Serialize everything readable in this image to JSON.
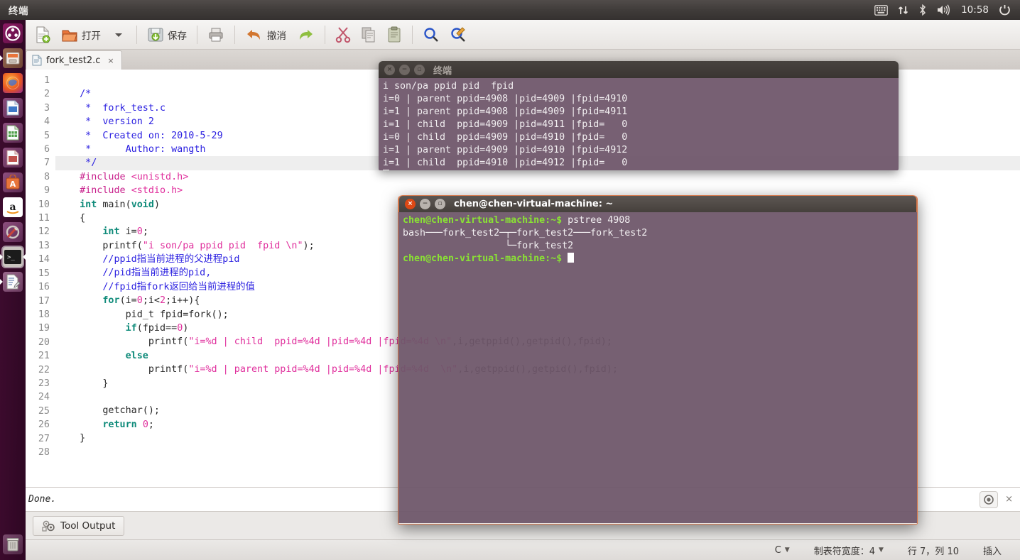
{
  "top_panel": {
    "app_title": "终端",
    "clock": "10:58",
    "tray_icons": [
      "keyboard-icon",
      "network-icon",
      "bluetooth-icon",
      "volume-icon",
      "power-icon"
    ]
  },
  "launcher": {
    "items": [
      {
        "name": "ubuntu-dash",
        "label": "Dash"
      },
      {
        "name": "files",
        "label": "文件"
      },
      {
        "name": "firefox",
        "label": "Firefox"
      },
      {
        "name": "libreoffice-writer",
        "label": "LibreOffice Writer"
      },
      {
        "name": "libreoffice-calc",
        "label": "LibreOffice Calc"
      },
      {
        "name": "libreoffice-impress",
        "label": "LibreOffice Impress"
      },
      {
        "name": "ubuntu-software-center",
        "label": "Ubuntu 软件中心"
      },
      {
        "name": "amazon",
        "label": "Amazon"
      },
      {
        "name": "system-settings",
        "label": "系统设置"
      },
      {
        "name": "terminal",
        "label": "终端"
      },
      {
        "name": "text-editor",
        "label": "文本编辑器"
      }
    ],
    "trash_label": "回收站"
  },
  "gedit": {
    "toolbar": [
      {
        "name": "new-file-button",
        "label": ""
      },
      {
        "name": "open-file-button",
        "label": "打开"
      },
      {
        "name": "open-dropdown-button",
        "label": ""
      },
      {
        "name": "save-button",
        "label": "保存"
      },
      {
        "name": "print-button",
        "label": ""
      },
      {
        "name": "undo-button",
        "label": "撤消"
      },
      {
        "name": "redo-button",
        "label": ""
      },
      {
        "name": "cut-button",
        "label": ""
      },
      {
        "name": "copy-button",
        "label": ""
      },
      {
        "name": "paste-button",
        "label": ""
      },
      {
        "name": "find-button",
        "label": ""
      },
      {
        "name": "replace-button",
        "label": ""
      }
    ],
    "tab": {
      "filename": "fork_test2.c",
      "close_label": "×"
    },
    "line_numbers": [
      "1",
      "2",
      "3",
      "4",
      "5",
      "6",
      "7",
      "8",
      "9",
      "10",
      "11",
      "12",
      "13",
      "14",
      "15",
      "16",
      "17",
      "18",
      "19",
      "20",
      "21",
      "22",
      "23",
      "24",
      "25",
      "26",
      "27",
      "28"
    ],
    "highlight_line": 7,
    "output": {
      "text": "Done.",
      "close_label": "×"
    },
    "bottom_tab": {
      "label": "Tool Output",
      "icon": "gears-icon"
    },
    "statusbar": {
      "language": "C",
      "tab_width": "制表符宽度：4",
      "position": "行 7，列 10",
      "insert_mode": "插入"
    }
  },
  "code_lines": [
    {
      "n": 1,
      "segs": []
    },
    {
      "n": 2,
      "segs": [
        {
          "t": "  ",
          "c": ""
        },
        {
          "t": "/*",
          "c": "cmt"
        }
      ]
    },
    {
      "n": 3,
      "segs": [
        {
          "t": "   *  fork_test.c",
          "c": "cmt"
        }
      ]
    },
    {
      "n": 4,
      "segs": [
        {
          "t": "   *  version 2",
          "c": "cmt"
        }
      ]
    },
    {
      "n": 5,
      "segs": [
        {
          "t": "   *  Created on: 2010-5-29",
          "c": "cmt"
        }
      ]
    },
    {
      "n": 6,
      "segs": [
        {
          "t": "   *      Author: wangth",
          "c": "cmt"
        }
      ]
    },
    {
      "n": 7,
      "segs": [
        {
          "t": "   */",
          "c": "cmt"
        }
      ]
    },
    {
      "n": 8,
      "segs": [
        {
          "t": "  ",
          "c": ""
        },
        {
          "t": "#include ",
          "c": "pp"
        },
        {
          "t": "<unistd.h>",
          "c": "pph"
        }
      ]
    },
    {
      "n": 9,
      "segs": [
        {
          "t": "  ",
          "c": ""
        },
        {
          "t": "#include ",
          "c": "pp"
        },
        {
          "t": "<stdio.h>",
          "c": "pph"
        }
      ]
    },
    {
      "n": 10,
      "segs": [
        {
          "t": "  ",
          "c": ""
        },
        {
          "t": "int",
          "c": "kw"
        },
        {
          "t": " main(",
          "c": ""
        },
        {
          "t": "void",
          "c": "kw"
        },
        {
          "t": ")",
          "c": ""
        }
      ]
    },
    {
      "n": 11,
      "segs": [
        {
          "t": "  {",
          "c": ""
        }
      ]
    },
    {
      "n": 12,
      "segs": [
        {
          "t": "      ",
          "c": ""
        },
        {
          "t": "int",
          "c": "kw"
        },
        {
          "t": " i=",
          "c": ""
        },
        {
          "t": "0",
          "c": "num"
        },
        {
          "t": ";",
          "c": ""
        }
      ]
    },
    {
      "n": 13,
      "segs": [
        {
          "t": "      printf(",
          "c": ""
        },
        {
          "t": "\"i son/pa ppid pid  fpid \\n\"",
          "c": "str"
        },
        {
          "t": ");",
          "c": ""
        }
      ]
    },
    {
      "n": 14,
      "segs": [
        {
          "t": "      //ppid指当前进程的父进程pid",
          "c": "cmt"
        }
      ]
    },
    {
      "n": 15,
      "segs": [
        {
          "t": "      //pid指当前进程的pid,",
          "c": "cmt"
        }
      ]
    },
    {
      "n": 16,
      "segs": [
        {
          "t": "      //fpid指fork返回给当前进程的值",
          "c": "cmt"
        }
      ]
    },
    {
      "n": 17,
      "segs": [
        {
          "t": "      ",
          "c": ""
        },
        {
          "t": "for",
          "c": "kw"
        },
        {
          "t": "(i=",
          "c": ""
        },
        {
          "t": "0",
          "c": "num"
        },
        {
          "t": ";i<",
          "c": ""
        },
        {
          "t": "2",
          "c": "num"
        },
        {
          "t": ";i++){",
          "c": ""
        }
      ]
    },
    {
      "n": 18,
      "segs": [
        {
          "t": "          pid_t fpid=fork();",
          "c": ""
        }
      ]
    },
    {
      "n": 19,
      "segs": [
        {
          "t": "          ",
          "c": ""
        },
        {
          "t": "if",
          "c": "kw"
        },
        {
          "t": "(fpid==",
          "c": ""
        },
        {
          "t": "0",
          "c": "num"
        },
        {
          "t": ")",
          "c": ""
        }
      ]
    },
    {
      "n": 20,
      "segs": [
        {
          "t": "              printf(",
          "c": ""
        },
        {
          "t": "\"i=%d | child  ppid=%4d |pid=%4d |fpid=%4d \\n\"",
          "c": "str"
        },
        {
          "t": ",i,getppid(),getpid(),fpid);",
          "c": ""
        }
      ]
    },
    {
      "n": 21,
      "segs": [
        {
          "t": "          ",
          "c": ""
        },
        {
          "t": "else",
          "c": "kw"
        }
      ]
    },
    {
      "n": 22,
      "segs": [
        {
          "t": "              printf(",
          "c": ""
        },
        {
          "t": "\"i=%d | parent ppid=%4d |pid=%4d |fpid=%4d  \\n\"",
          "c": "str"
        },
        {
          "t": ",i,getppid(),getpid(),fpid);",
          "c": ""
        }
      ]
    },
    {
      "n": 23,
      "segs": [
        {
          "t": "      }",
          "c": ""
        }
      ]
    },
    {
      "n": 24,
      "segs": []
    },
    {
      "n": 25,
      "segs": [
        {
          "t": "      getchar();",
          "c": ""
        }
      ]
    },
    {
      "n": 26,
      "segs": [
        {
          "t": "      ",
          "c": ""
        },
        {
          "t": "return",
          "c": "kw"
        },
        {
          "t": " ",
          "c": ""
        },
        {
          "t": "0",
          "c": "num"
        },
        {
          "t": ";",
          "c": ""
        }
      ]
    },
    {
      "n": 27,
      "segs": [
        {
          "t": "  }",
          "c": ""
        }
      ]
    },
    {
      "n": 28,
      "segs": []
    }
  ],
  "terminal_1": {
    "title": "终端",
    "active": false,
    "lines": [
      "i son/pa ppid pid  fpid",
      "i=0 | parent ppid=4908 |pid=4909 |fpid=4910",
      "i=1 | parent ppid=4908 |pid=4909 |fpid=4911",
      "i=1 | child  ppid=4909 |pid=4911 |fpid=   0",
      "i=0 | child  ppid=4909 |pid=4910 |fpid=   0",
      "i=1 | parent ppid=4909 |pid=4910 |fpid=4912",
      "i=1 | child  ppid=4910 |pid=4912 |fpid=   0"
    ]
  },
  "terminal_2": {
    "title": "chen@chen-virtual-machine: ~",
    "active": true,
    "prompt": "chen@chen-virtual-machine:~$",
    "command": " pstree 4908",
    "output_lines": [
      "bash───fork_test2─┬─fork_test2───fork_test2",
      "                  └─fork_test2"
    ],
    "prompt2": "chen@chen-virtual-machine:~$"
  }
}
